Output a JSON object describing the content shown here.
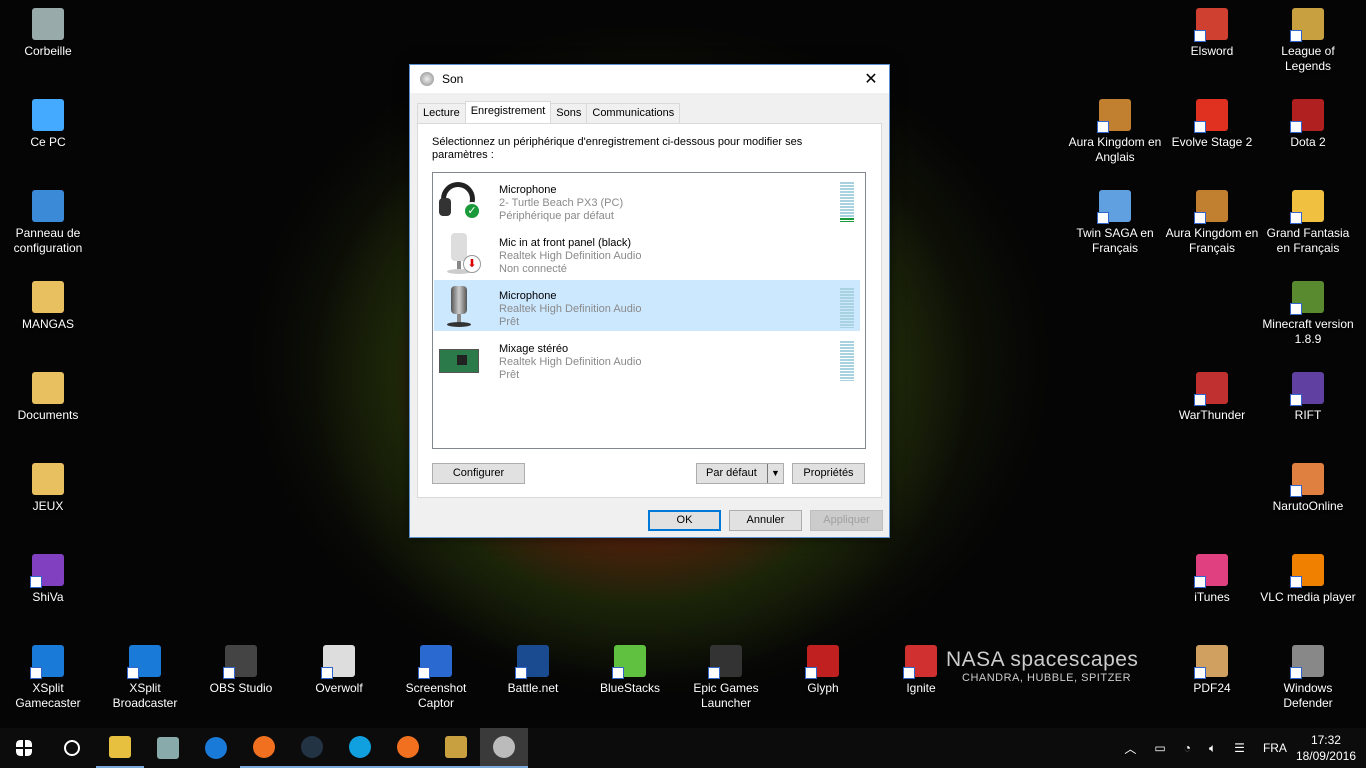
{
  "desktop_icons": [
    {
      "label": "Corbeille",
      "color": "#9aa",
      "col": "l1",
      "row": 0
    },
    {
      "label": "Ce PC",
      "color": "#4af",
      "col": "l1",
      "row": 1
    },
    {
      "label": "Panneau de configuration",
      "color": "#3a8ad8",
      "col": "l1",
      "row": 2
    },
    {
      "label": "MANGAS",
      "color": "#e8c060",
      "col": "l1",
      "row": 3
    },
    {
      "label": "Documents",
      "color": "#e8c060",
      "col": "l1",
      "row": 4
    },
    {
      "label": "JEUX",
      "color": "#e8c060",
      "col": "l1",
      "row": 5
    },
    {
      "label": "ShiVa",
      "color": "#8040c0",
      "col": "l1",
      "row": 6
    },
    {
      "label": "XSplit Gamecaster",
      "color": "#1a7ad8",
      "col": "b0",
      "row": 7
    },
    {
      "label": "XSplit Broadcaster",
      "color": "#1a7ad8",
      "col": "b1",
      "row": 7
    },
    {
      "label": "OBS Studio",
      "color": "#444",
      "col": "b2",
      "row": 7
    },
    {
      "label": "Overwolf",
      "color": "#ddd",
      "col": "b3",
      "row": 7
    },
    {
      "label": "Screenshot Captor",
      "color": "#2a6ad0",
      "col": "b4",
      "row": 7
    },
    {
      "label": "Battle.net",
      "color": "#1a4a90",
      "col": "b5",
      "row": 7
    },
    {
      "label": "BlueStacks",
      "color": "#60c040",
      "col": "b6",
      "row": 7
    },
    {
      "label": "Epic Games Launcher",
      "color": "#333",
      "col": "b7",
      "row": 7
    },
    {
      "label": "Glyph",
      "color": "#c02020",
      "col": "b8",
      "row": 7
    },
    {
      "label": "Ignite",
      "color": "#d03030",
      "col": "b9",
      "row": 7
    },
    {
      "label": "Aura Kingdom en Anglais",
      "color": "#c08030",
      "col": "r0",
      "row": 1
    },
    {
      "label": "Twin SAGA en Français",
      "color": "#60a0e0",
      "col": "r0",
      "row": 2
    },
    {
      "label": "Elsword",
      "color": "#d04030",
      "col": "r1",
      "row": 0
    },
    {
      "label": "Evolve Stage 2",
      "color": "#e03020",
      "col": "r1",
      "row": 1
    },
    {
      "label": "Aura Kingdom en Français",
      "color": "#c08030",
      "col": "r1",
      "row": 2
    },
    {
      "label": "WarThunder",
      "color": "#c03030",
      "col": "r1",
      "row": 4
    },
    {
      "label": "iTunes",
      "color": "#e04080",
      "col": "r1",
      "row": 6
    },
    {
      "label": "PDF24",
      "color": "#d0a060",
      "col": "r1",
      "row": 7
    },
    {
      "label": "League of Legends",
      "color": "#c9a040",
      "col": "r2",
      "row": 0
    },
    {
      "label": "Dota 2",
      "color": "#b02020",
      "col": "r2",
      "row": 1
    },
    {
      "label": "Grand Fantasia en Français",
      "color": "#f0c040",
      "col": "r2",
      "row": 2
    },
    {
      "label": "Minecraft version 1.8.9",
      "color": "#5a8a30",
      "col": "r2",
      "row": 3
    },
    {
      "label": "RIFT",
      "color": "#6040a0",
      "col": "r2",
      "row": 4
    },
    {
      "label": "NarutoOnline",
      "color": "#e08040",
      "col": "r2",
      "row": 5
    },
    {
      "label": "VLC media player",
      "color": "#f08000",
      "col": "r2",
      "row": 6
    },
    {
      "label": "Windows Defender",
      "color": "#888",
      "col": "r2",
      "row": 7
    }
  ],
  "watermark": {
    "title": "NASA spacescapes",
    "subtitle": "CHANDRA, HUBBLE, SPITZER"
  },
  "dialog": {
    "title": "Son",
    "tabs": [
      "Lecture",
      "Enregistrement",
      "Sons",
      "Communications"
    ],
    "selected_tab": 1,
    "instruction": "Sélectionnez un périphérique d'enregistrement ci-dessous pour modifier ses paramètres :",
    "devices": [
      {
        "name": "Microphone",
        "driver": "2- Turtle Beach PX3 (PC)",
        "status": "Périphérique par défaut",
        "icon": "headset-icon",
        "badge": "default-check",
        "level": 0.1
      },
      {
        "name": "Mic in at front panel (black)",
        "driver": "Realtek High Definition Audio",
        "status": "Non connecté",
        "icon": "microphone-icon",
        "badge": "disconnected-arrow",
        "level": null
      },
      {
        "name": "Microphone",
        "driver": "Realtek High Definition Audio",
        "status": "Prêt",
        "icon": "microphone-icon",
        "badge": null,
        "level": 0
      },
      {
        "name": "Mixage stéréo",
        "driver": "Realtek High Definition Audio",
        "status": "Prêt",
        "icon": "sound-card-icon",
        "badge": null,
        "level": 0
      }
    ],
    "selected_device": 2,
    "buttons": {
      "configure": "Configurer",
      "set_default": "Par défaut",
      "properties": "Propriétés",
      "ok": "OK",
      "cancel": "Annuler",
      "apply": "Appliquer"
    }
  },
  "taskbar": {
    "apps": [
      "file-explorer",
      "control-panel",
      "edge",
      "firefox",
      "steam",
      "skype",
      "firefox",
      "league-of-legends",
      "sound"
    ],
    "active": 8,
    "tray": {
      "language": "FRA",
      "time": "17:32",
      "date": "18/09/2016"
    }
  }
}
